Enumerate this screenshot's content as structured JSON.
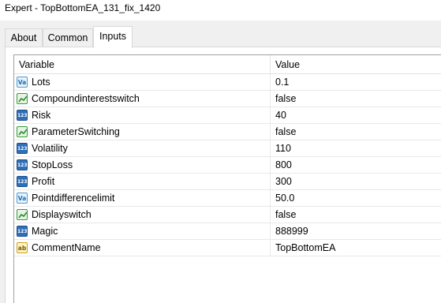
{
  "window": {
    "title": "Expert - TopBottomEA_131_fix_1420"
  },
  "tabs": [
    {
      "label": "About"
    },
    {
      "label": "Common"
    },
    {
      "label": "Inputs",
      "active": true
    }
  ],
  "table": {
    "columns": {
      "variable": "Variable",
      "value": "Value"
    },
    "rows": [
      {
        "name": "Lots",
        "value": "0.1",
        "icon": "double-type-icon"
      },
      {
        "name": "Compoundinterestswitch",
        "value": "false",
        "icon": "bool-type-icon"
      },
      {
        "name": "Risk",
        "value": "40",
        "icon": "int-type-icon"
      },
      {
        "name": "ParameterSwitching",
        "value": "false",
        "icon": "bool-type-icon"
      },
      {
        "name": "Volatility",
        "value": "110",
        "icon": "int-type-icon"
      },
      {
        "name": "StopLoss",
        "value": "800",
        "icon": "int-type-icon"
      },
      {
        "name": "Profit",
        "value": "300",
        "icon": "int-type-icon"
      },
      {
        "name": "Pointdifferencelimit",
        "value": "50.0",
        "icon": "double-type-icon"
      },
      {
        "name": "Displayswitch",
        "value": "false",
        "icon": "bool-type-icon"
      },
      {
        "name": "Magic",
        "value": "888999",
        "icon": "int-type-icon"
      },
      {
        "name": "CommentName",
        "value": "TopBottomEA",
        "icon": "string-type-icon"
      }
    ]
  },
  "icon_glyphs": {
    "int": "123",
    "double": "Va",
    "string": "ab"
  }
}
